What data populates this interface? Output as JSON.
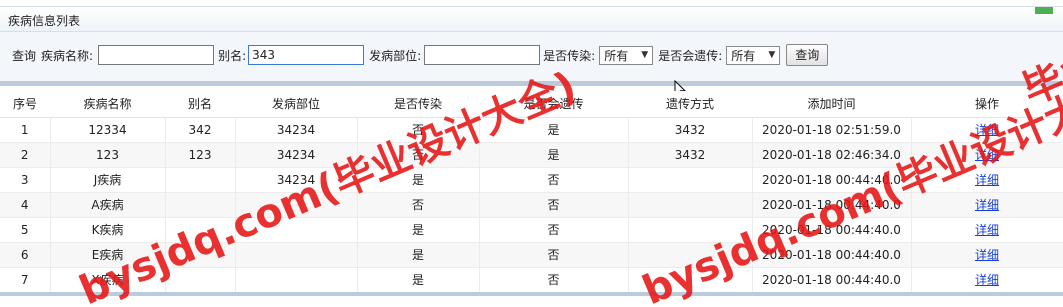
{
  "panel": {
    "title": "疾病信息列表",
    "accent_color": "#4caf50"
  },
  "search": {
    "prefix": "查询",
    "disease_name_label": "疾病名称:",
    "disease_name_value": "",
    "alias_label": "别名:",
    "alias_value": "343",
    "site_label": "发病部位:",
    "site_value": "",
    "contagious_label": "是否传染:",
    "contagious_value": "所有",
    "hereditary_label": "是否会遗传:",
    "hereditary_value": "所有",
    "query_button": "查询"
  },
  "table": {
    "headers": [
      "序号",
      "疾病名称",
      "别名",
      "发病部位",
      "是否传染",
      "是否会遗传",
      "遗传方式",
      "添加时间",
      "操作"
    ],
    "rows": [
      [
        "1",
        "12334",
        "342",
        "34234",
        "否",
        "是",
        "3432",
        "2020-01-18 02:51:59.0",
        "详细"
      ],
      [
        "2",
        "123",
        "123",
        "34234",
        "否",
        "是",
        "3432",
        "2020-01-18 02:46:34.0",
        "详细"
      ],
      [
        "3",
        "J疾病",
        "",
        "34234",
        "是",
        "否",
        "",
        "2020-01-18 00:44:40.0",
        "详细"
      ],
      [
        "4",
        "A疾病",
        "",
        "",
        "否",
        "否",
        "",
        "2020-01-18 00:44:40.0",
        "详细"
      ],
      [
        "5",
        "K疾病",
        "",
        "",
        "是",
        "否",
        "",
        "2020-01-18 00:44:40.0",
        "详细"
      ],
      [
        "6",
        "E疾病",
        "",
        "",
        "是",
        "否",
        "",
        "2020-01-18 00:44:40.0",
        "详细"
      ],
      [
        "7",
        "X疾病",
        "",
        "",
        "是",
        "否",
        "",
        "2020-01-18 00:44:40.0",
        "详细"
      ]
    ]
  },
  "watermarks": [
    "bysjdq.com(毕业设计大全)",
    "bysjdq.com(毕业设计大全)",
    "毕业设计大"
  ]
}
